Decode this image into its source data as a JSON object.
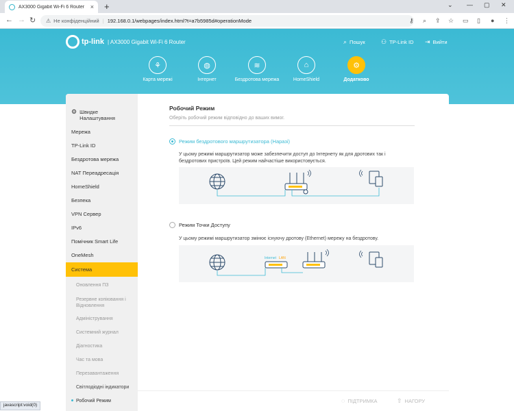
{
  "browser": {
    "tab_title": "AX3000 Gigabit Wi-Fi 6 Router",
    "tab_close": "×",
    "new_tab": "+",
    "security_label": "Не конфіденційний",
    "url": "192.168.0.1/webpages/index.html?t=a7b5985d#operationMode",
    "status_url": "javascript:void(0)"
  },
  "router": {
    "brand": "tp-link",
    "model": "| AX3000 Gigabit Wi-Fi 6 Router",
    "top_links": {
      "search": "Пошук",
      "tplink_id": "TP-Link ID",
      "logout": "Вийти"
    },
    "nav": [
      {
        "label": "Карта мережі",
        "icon": "network-map-icon"
      },
      {
        "label": "Інтернет",
        "icon": "globe-icon"
      },
      {
        "label": "Бездротова мережа",
        "icon": "wifi-icon"
      },
      {
        "label": "HomeShield",
        "icon": "home-shield-icon"
      },
      {
        "label": "Додатково",
        "icon": "gear-icon",
        "active": true
      }
    ]
  },
  "sidebar": {
    "quick_setup": "Швидке Налаштування",
    "items": [
      "Мережа",
      "TP-Link ID",
      "Бездротова мережа",
      "NAT Переадресація",
      "HomeShield",
      "Безпека",
      "VPN Сервер",
      "IPv6",
      "Помічник Smart Life",
      "OneMesh"
    ],
    "active_item": "Система",
    "sub_items": [
      "Оновлення ПЗ",
      "Резервне копіювання і Відновлення",
      "Адміністрування",
      "Системний журнал",
      "Діагностика",
      "Час та мова",
      "Перезавантаження",
      "Світлодіодні індикатори",
      "Робочий Режим"
    ]
  },
  "content": {
    "title": "Робочий Режим",
    "description": "Оберіть робочий режим відповідно до ваших вимог.",
    "options": [
      {
        "label": "Режим бездротового маршрутизатора (Наразі)",
        "checked": true,
        "description": "У цьому режимі маршрутизатор може забезпечити доступ до Інтернету як для дротових так і бездротових пристроїв. Цей режим найчастіше використовується."
      },
      {
        "label": "Режим Точки Доступу",
        "checked": false,
        "description": "У цьому режимі маршрутизатор змінює існуючу дротову (Ethernet) мережу на бездротову."
      }
    ],
    "diagram2_labels": {
      "internet": "Internet",
      "lan": "LAN"
    }
  },
  "footer": {
    "support": "ПІДТРИМКА",
    "top": "НАГОРУ"
  },
  "colors": {
    "header": "#3bbad4",
    "accent": "#ffc107",
    "link": "#3bbad4"
  }
}
